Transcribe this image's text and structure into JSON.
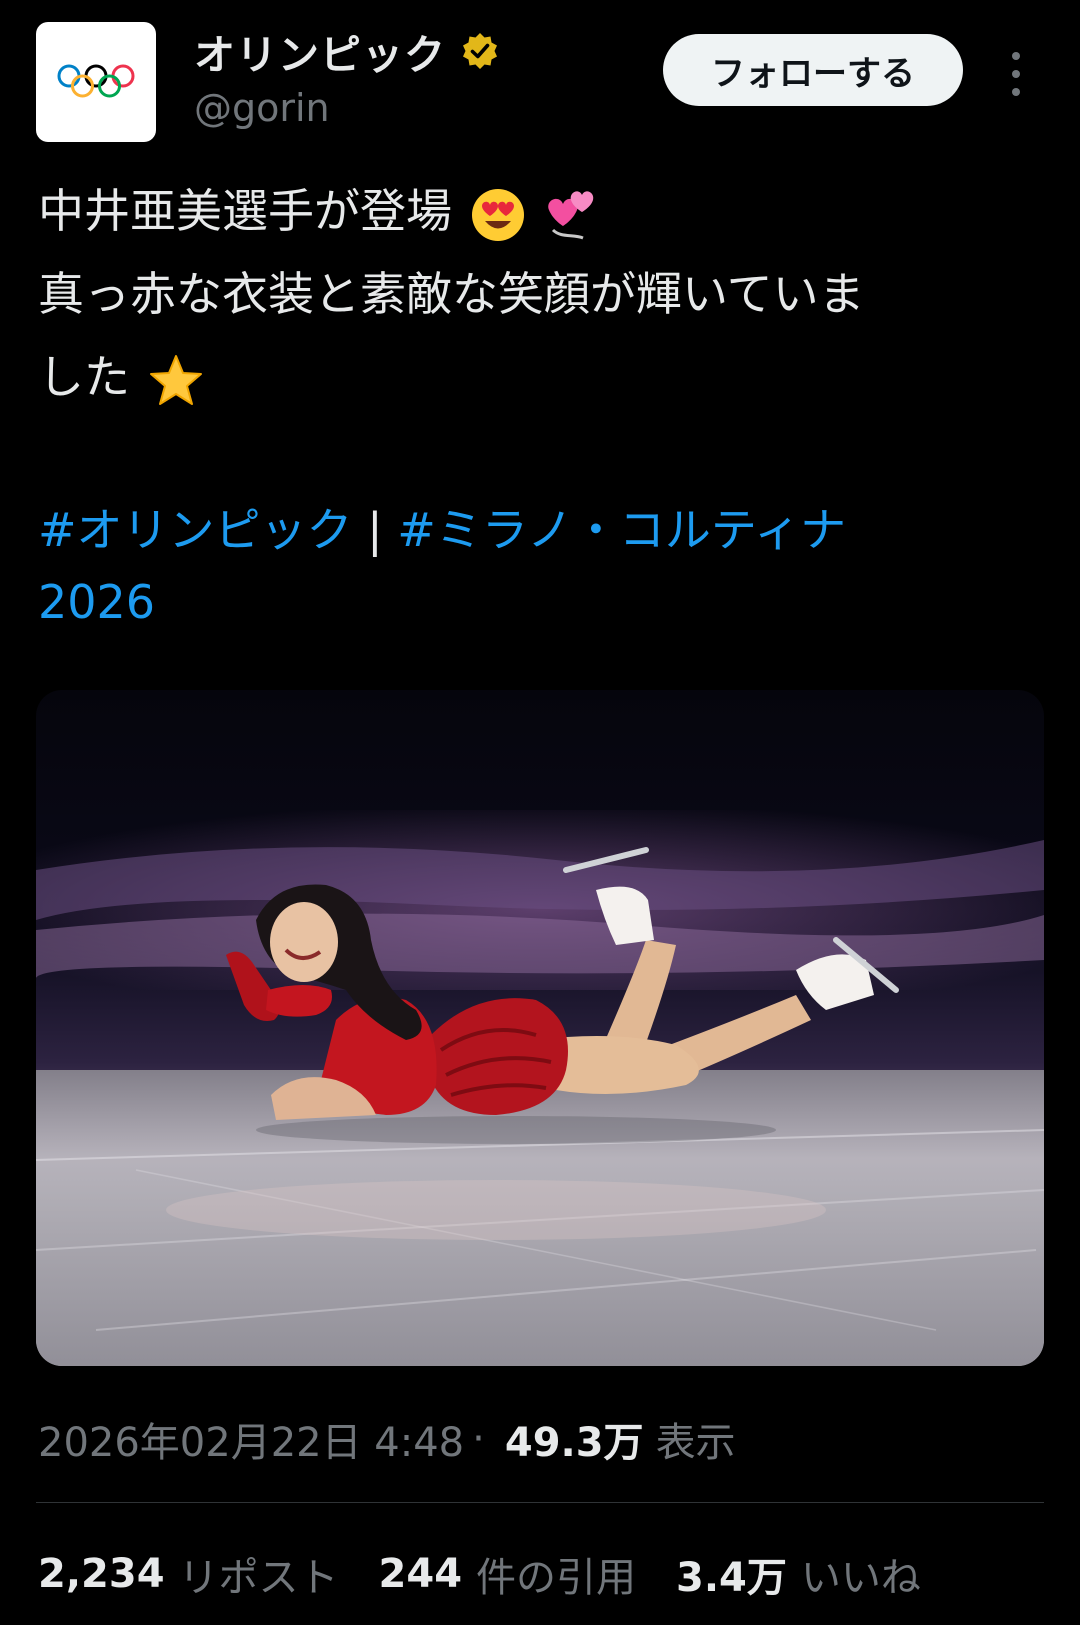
{
  "author": {
    "display_name": "オリンピック",
    "handle": "@gorin",
    "verified_badge": "verified-gold-icon",
    "avatar_icon": "olympic-rings-logo"
  },
  "actions": {
    "follow_label": "フォローする",
    "more_icon": "more-vertical-icon"
  },
  "tweet": {
    "line1": "中井亜美選手が登場",
    "line1_emojis": [
      "smiling-face-heart-eyes",
      "revolving-hearts"
    ],
    "line2": "真っ赤な衣装と素敵な笑顔が輝いていま",
    "line3": "した",
    "line3_emoji": "star",
    "hashtag1": "#オリンピック",
    "separator": "|",
    "hashtag2": "#ミラノ・コルティナ",
    "hashtag2_cont": "2026"
  },
  "meta": {
    "datetime": "2026年02月22日 4:48",
    "dot": "·",
    "views_count": "49.3万",
    "views_label": "表示"
  },
  "stats": {
    "reposts_count": "2,234",
    "reposts_label": "リポスト",
    "quotes_count": "244",
    "quotes_label": "件の引用",
    "likes_count": "3.4万",
    "likes_label": "いいね"
  },
  "colors": {
    "background": "#000000",
    "text": "#e7e9ea",
    "secondary": "#71767b",
    "link": "#1d9bf0",
    "verified": "#e2b719"
  }
}
